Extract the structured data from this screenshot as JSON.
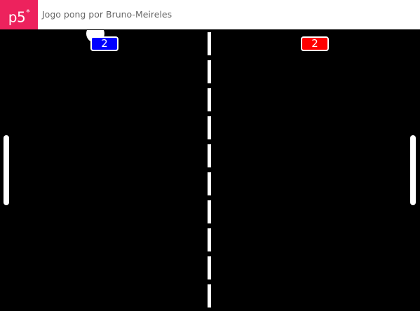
{
  "header": {
    "logo_text": "p5",
    "logo_mark": "*",
    "sketch_title": "Jogo pong por Bruno-Meireles"
  },
  "game": {
    "score_left": "2",
    "score_right": "2"
  },
  "colors": {
    "p5_brand": "#ed225d",
    "canvas_background": "#000000",
    "score_left_fill": "#0000ff",
    "score_right_fill": "#ff0000",
    "net": "#ffffff",
    "paddle": "#ffffff",
    "ball": "#ffffff"
  }
}
